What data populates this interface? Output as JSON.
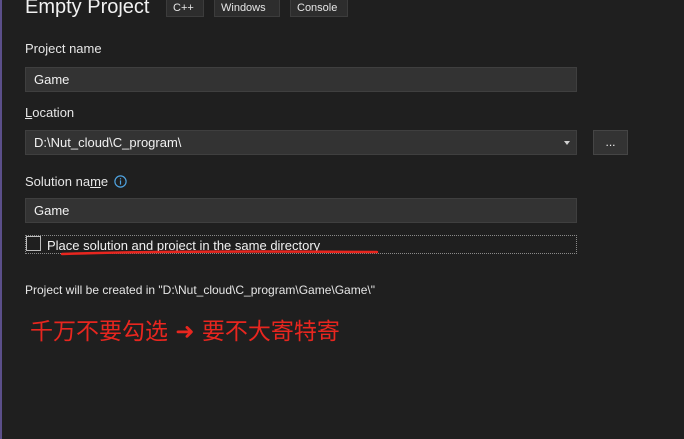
{
  "header": {
    "title": "Empty Project",
    "tags": [
      "C++",
      "Windows",
      "Console"
    ]
  },
  "form": {
    "project_name": {
      "label": "Project name",
      "value": "Game"
    },
    "location": {
      "label_prefix": "",
      "label_underlined": "L",
      "label_rest": "ocation",
      "value": "D:\\Nut_cloud\\C_program\\",
      "browse_label": "..."
    },
    "solution_name": {
      "label_prefix": "Solution na",
      "label_underlined": "m",
      "label_rest": "e",
      "value": "Game",
      "info_icon": "info-icon"
    },
    "same_directory": {
      "label_prefix": "Place solution and project in the same ",
      "label_underlined": "d",
      "label_rest": "irectory",
      "checked": false
    },
    "path_info": "Project will be created in \"D:\\Nut_cloud\\C_program\\Game\\Game\\\""
  },
  "annotation": {
    "text": "千万不要勾选 ➜ 要不大寄特寄",
    "color": "#e8261f"
  },
  "colors": {
    "background": "#1f1f1f",
    "field_background": "#333333",
    "info_blue": "#4fa3e0",
    "annotation_red": "#e8261f"
  }
}
